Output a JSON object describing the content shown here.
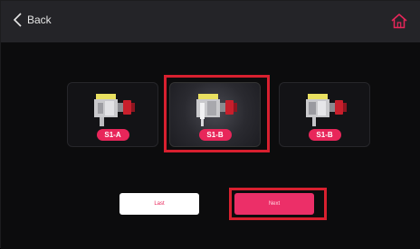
{
  "header": {
    "back_label": "Back"
  },
  "cards": [
    {
      "label": "S1-A",
      "selected": false
    },
    {
      "label": "S1-B",
      "selected": true
    },
    {
      "label": "S1-B",
      "selected": false
    }
  ],
  "buttons": {
    "last_label": "Last",
    "next_label": "Next"
  },
  "colors": {
    "accent": "#e8265a",
    "highlight": "#d8202f",
    "topbar": "#242428"
  }
}
